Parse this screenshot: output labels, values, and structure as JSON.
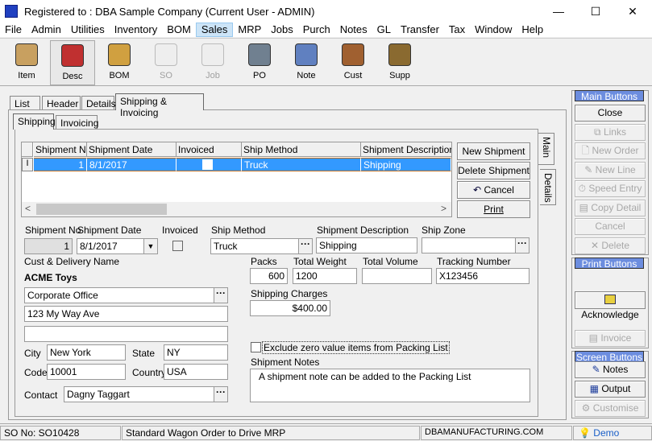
{
  "window": {
    "title": "Registered to : DBA Sample Company (Current User - ADMIN)",
    "minimize": "—",
    "maximize": "☐",
    "close": "✕"
  },
  "menu": [
    "File",
    "Admin",
    "Utilities",
    "Inventory",
    "BOM",
    "Sales",
    "MRP",
    "Jobs",
    "Purch",
    "Notes",
    "GL",
    "Transfer",
    "Tax",
    "Window",
    "Help"
  ],
  "menu_active": "Sales",
  "toolbar": [
    {
      "label": "Item",
      "icon": "item-icon",
      "color": "#c8a060"
    },
    {
      "label": "Desc",
      "icon": "desc-icon",
      "color": "#c03030"
    },
    {
      "label": "BOM",
      "icon": "bom-icon",
      "color": "#d0a040"
    },
    {
      "label": "SO",
      "icon": "so-icon",
      "color": "#d0d0d0"
    },
    {
      "label": "Job",
      "icon": "job-icon",
      "color": "#d0d0d0"
    },
    {
      "label": "PO",
      "icon": "po-icon",
      "color": "#708090"
    },
    {
      "label": "Note",
      "icon": "note-icon",
      "color": "#6080c0"
    },
    {
      "label": "Cust",
      "icon": "cust-icon",
      "color": "#a06030"
    },
    {
      "label": "Supp",
      "icon": "supp-icon",
      "color": "#8a6a30"
    }
  ],
  "tabs": [
    "List",
    "Header",
    "Details",
    "Shipping & Invoicing"
  ],
  "subtabs": [
    "Shipping",
    "Invoicing"
  ],
  "side_tabs": [
    "Main",
    "Details"
  ],
  "grid": {
    "columns": [
      "Shipment No",
      "Shipment Date",
      "Invoiced",
      "Ship Method",
      "Shipment Description"
    ],
    "rows": [
      {
        "no": "1",
        "date": "8/1/2017",
        "invoiced": false,
        "method": "Truck",
        "desc": "Shipping"
      }
    ]
  },
  "grid_buttons": {
    "new": "New Shipment",
    "delete": "Delete Shipment",
    "cancel": "Cancel",
    "print": "Print"
  },
  "form": {
    "shipment_no_label": "Shipment No",
    "shipment_no": "1",
    "shipment_date_label": "Shipment Date",
    "shipment_date": "8/1/2017",
    "invoiced_label": "Invoiced",
    "ship_method_label": "Ship Method",
    "ship_method": "Truck",
    "shipment_desc_label": "Shipment Description",
    "shipment_desc": "Shipping",
    "ship_zone_label": "Ship Zone",
    "ship_zone": "",
    "cust_delivery_label": "Cust & Delivery Name",
    "cust_name": "ACME Toys",
    "address_name": "Corporate Office",
    "address1": "123 My Way Ave",
    "address2": "",
    "city_label": "City",
    "city": "New York",
    "state_label": "State",
    "state": "NY",
    "code_label": "Code",
    "code": "10001",
    "country_label": "Country",
    "country": "USA",
    "contact_label": "Contact",
    "contact": "Dagny Taggart",
    "packs_label": "Packs",
    "packs": "600",
    "total_weight_label": "Total Weight",
    "total_weight": "1200",
    "total_volume_label": "Total Volume",
    "total_volume": "",
    "tracking_label": "Tracking Number",
    "tracking": "X123456",
    "shipping_charges_label": "Shipping Charges",
    "shipping_charges": "$400.00",
    "exclude_zero_label": "Exclude zero value items from Packing List",
    "exclude_zero": false,
    "notes_label": "Shipment Notes",
    "notes": "A shipment note can be added to the Packing List"
  },
  "right_panel": {
    "main_title": "Main Buttons",
    "main": [
      {
        "label": "Close",
        "enabled": true
      },
      {
        "label": "Links",
        "enabled": false
      },
      {
        "label": "New Order",
        "enabled": false
      },
      {
        "label": "New Line",
        "enabled": false
      },
      {
        "label": "Speed Entry",
        "enabled": false
      },
      {
        "label": "Copy Detail",
        "enabled": false
      },
      {
        "label": "Cancel",
        "enabled": false
      },
      {
        "label": "Delete",
        "enabled": false
      }
    ],
    "print_title": "Print Buttons",
    "acknowledge": "Acknowledge",
    "invoice": "Invoice",
    "screen_title": "Screen Buttons",
    "screen": [
      {
        "label": "Notes",
        "enabled": true
      },
      {
        "label": "Output",
        "enabled": true
      },
      {
        "label": "Customise",
        "enabled": false
      }
    ]
  },
  "status": {
    "so_no": "SO No: SO10428",
    "description": "Standard Wagon Order to Drive MRP",
    "website": "DBAMANUFACTURING.COM",
    "mode": "Demo"
  }
}
